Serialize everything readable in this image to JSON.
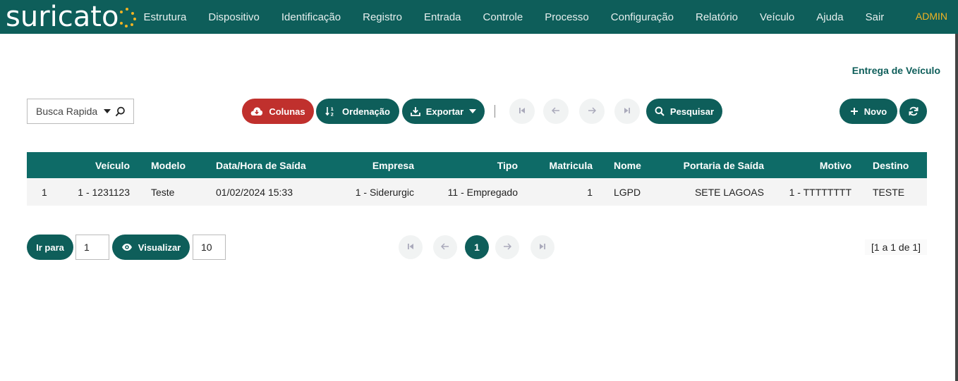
{
  "app": {
    "logo": "suricato",
    "user": "ADMIN",
    "colors": {
      "brand": "#0e5e5a",
      "accent": "#f0b323",
      "danger": "#c0302d"
    }
  },
  "nav": [
    "Estrutura",
    "Dispositivo",
    "Identificação",
    "Registro",
    "Entrada",
    "Controle",
    "Processo",
    "Configuração",
    "Relatório",
    "Veículo",
    "Ajuda",
    "Sair"
  ],
  "page": {
    "title": "Entrega de Veículo"
  },
  "toolbar": {
    "search_placeholder": "Busca Rapida",
    "columns_label": "Colunas",
    "sort_label": "Ordenação",
    "export_label": "Exportar",
    "search_label": "Pesquisar",
    "new_label": "Novo"
  },
  "table": {
    "headers": [
      "",
      "Veículo",
      "Modelo",
      "Data/Hora de Saída",
      "Empresa",
      "Tipo",
      "Matricula",
      "Nome",
      "Portaria de Saída",
      "Motivo",
      "Destino"
    ],
    "rows": [
      [
        "1",
        "1 - 1231123",
        "Teste",
        "01/02/2024 15:33",
        "1 - Siderurgic",
        "11 - Empregado",
        "1",
        "LGPD",
        "SETE LAGOAS",
        "1 - TTTTTTTT",
        "TESTE"
      ]
    ]
  },
  "footer": {
    "goto_label": "Ir para",
    "goto_value": "1",
    "view_label": "Visualizar",
    "page_size": "10",
    "current_page": "1",
    "count_text": "[1 a 1 de 1]"
  }
}
